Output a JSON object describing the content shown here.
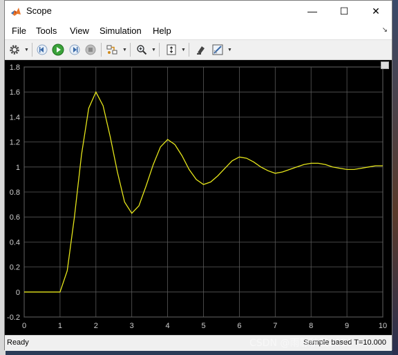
{
  "window": {
    "title": "Scope"
  },
  "window_controls": {
    "minimize": "—",
    "maximize": "☐",
    "close": "✕"
  },
  "menu": {
    "items": [
      "File",
      "Tools",
      "View",
      "Simulation",
      "Help"
    ],
    "undock_glyph": "↘"
  },
  "toolbar": {
    "icons": [
      "settings-icon",
      "step-back-icon",
      "run-icon",
      "step-forward-icon",
      "stop-icon",
      "signal-selector-icon",
      "zoom-icon",
      "autoscale-icon",
      "highlight-icon",
      "triggers-icon"
    ]
  },
  "status": {
    "left": "Ready",
    "right": "Sample based  T=10.000"
  },
  "watermark": "CSDN @雨静秋云2023",
  "colors": {
    "trace": "#e6e61a",
    "plot_bg": "#000000",
    "grid": "#5a5a5a",
    "tick_text": "#d0d0d0"
  },
  "chart_data": {
    "type": "line",
    "title": "",
    "xlabel": "",
    "ylabel": "",
    "xlim": [
      0,
      10
    ],
    "ylim": [
      -0.2,
      1.8
    ],
    "xticks": [
      0,
      1,
      2,
      3,
      4,
      5,
      6,
      7,
      8,
      9,
      10
    ],
    "yticks": [
      -0.2,
      0,
      0.2,
      0.4,
      0.6,
      0.8,
      1,
      1.2,
      1.4,
      1.6,
      1.8
    ],
    "ytick_labels": [
      "-0.2",
      "0",
      "0.2",
      "0.4",
      "0.6",
      "0.8",
      "1",
      "1.2",
      "1.4",
      "1.6",
      "1.8"
    ],
    "grid": true,
    "series": [
      {
        "x": [
          0,
          1,
          1.2,
          1.4,
          1.6,
          1.8,
          2,
          2.2,
          2.4,
          2.6,
          2.8,
          3,
          3.2,
          3.4,
          3.6,
          3.8,
          4,
          4.2,
          4.4,
          4.6,
          4.8,
          5,
          5.2,
          5.4,
          5.6,
          5.8,
          6,
          6.2,
          6.4,
          6.6,
          6.8,
          7,
          7.2,
          7.4,
          7.6,
          7.8,
          8,
          8.2,
          8.4,
          8.6,
          8.8,
          9,
          9.2,
          9.4,
          9.6,
          9.8,
          10
        ],
        "y": [
          0,
          0,
          0.17,
          0.6,
          1.1,
          1.47,
          1.6,
          1.49,
          1.24,
          0.96,
          0.72,
          0.63,
          0.69,
          0.85,
          1.02,
          1.16,
          1.22,
          1.18,
          1.09,
          0.98,
          0.9,
          0.86,
          0.88,
          0.93,
          0.99,
          1.05,
          1.08,
          1.07,
          1.04,
          1.0,
          0.97,
          0.95,
          0.96,
          0.98,
          1.0,
          1.02,
          1.03,
          1.03,
          1.02,
          1.0,
          0.99,
          0.98,
          0.98,
          0.99,
          1.0,
          1.01,
          1.01
        ]
      }
    ]
  }
}
